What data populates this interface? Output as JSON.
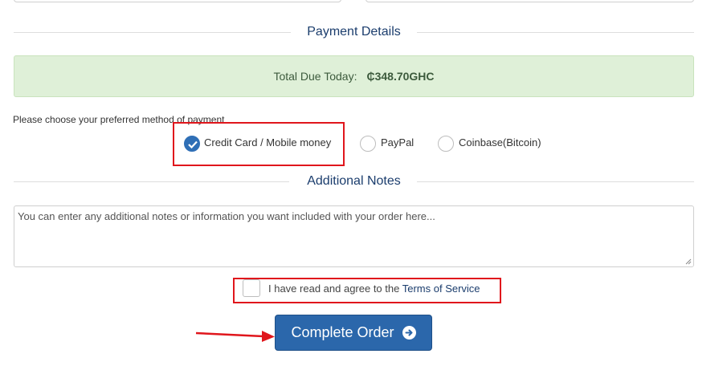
{
  "payment": {
    "section_title": "Payment Details",
    "total_label": "Total Due Today:",
    "total_amount": "₵348.70GHC",
    "choose_label": "Please choose your preferred method of payment",
    "methods": [
      {
        "label": "Credit Card / Mobile money",
        "selected": true
      },
      {
        "label": "PayPal",
        "selected": false
      },
      {
        "label": "Coinbase(Bitcoin)",
        "selected": false
      }
    ]
  },
  "notes": {
    "section_title": "Additional Notes",
    "placeholder": "You can enter any additional notes or information you want included with your order here..."
  },
  "tos": {
    "text": "I have read and agree to the ",
    "link": "Terms of Service"
  },
  "actions": {
    "complete_label": "Complete Order"
  },
  "colors": {
    "accent": "#2b67ab",
    "highlight": "#e0161c",
    "success_bg": "#dff0d8"
  }
}
